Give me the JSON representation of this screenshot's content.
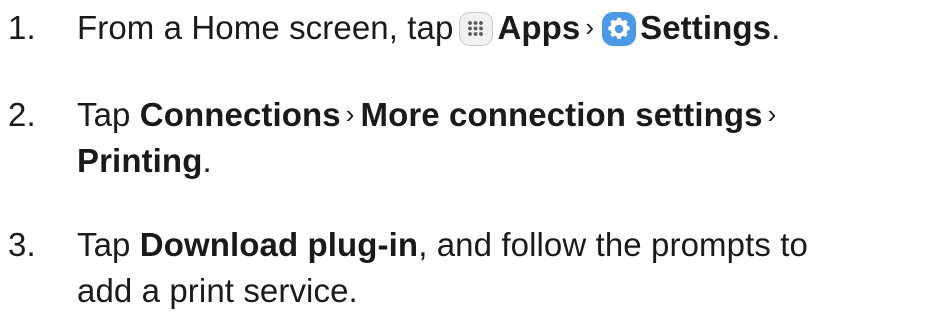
{
  "steps": [
    {
      "number": "1.",
      "parts": {
        "t1": "From a Home screen, tap",
        "apps": "Apps",
        "sep": "›",
        "settings": "Settings",
        "end": "."
      },
      "icons": [
        "apps-grid-icon",
        "settings-gear-icon"
      ]
    },
    {
      "number": "2.",
      "parts": {
        "t1": "Tap",
        "connections": "Connections",
        "sep1": "›",
        "more": "More connection settings",
        "sep2": "›",
        "printing": "Printing",
        "end": "."
      }
    },
    {
      "number": "3.",
      "parts": {
        "t1": "Tap",
        "download": "Download plug-in",
        "t2": ", and follow the prompts to",
        "t3": "add a print service."
      }
    }
  ],
  "colors": {
    "text": "#1a1a1a",
    "apps_icon_bg": "#f1f1f1",
    "apps_icon_border": "#c9c9c9",
    "settings_icon_bg": "#4a9ae8"
  }
}
